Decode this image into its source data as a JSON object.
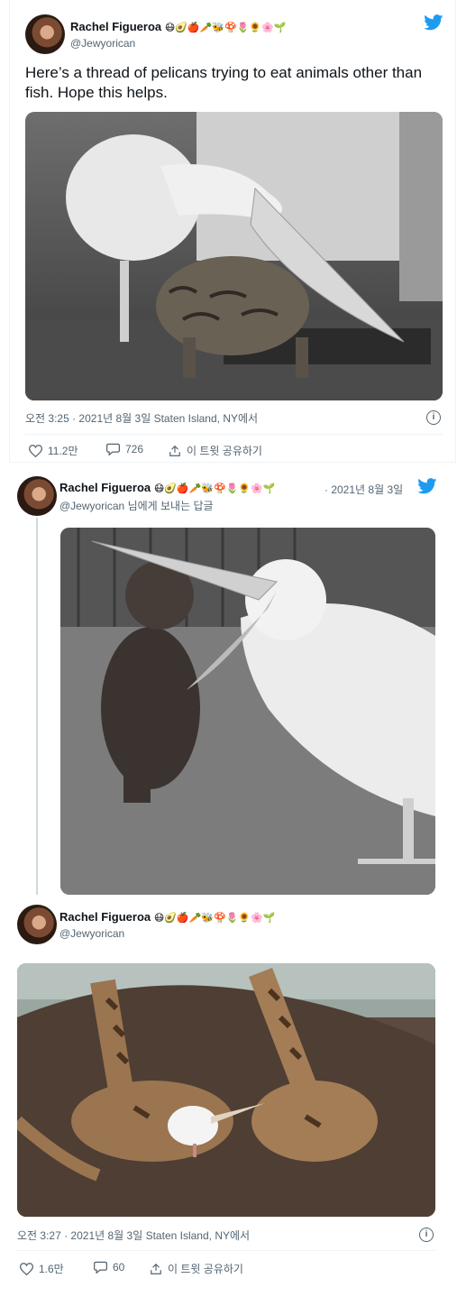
{
  "tweet1": {
    "author_name": "Rachel Figueroa",
    "emoji": "😷🥑🍎🥕🐝🍄🌷🌻🌸🌱",
    "handle": "@Jewyorican",
    "text": "Here’s a thread of pelicans trying to eat animals other than fish. Hope this helps.",
    "timestamp": "오전 3:25 · 2021년 8월 3일 Staten Island, NY에서",
    "likes": "11.2만",
    "replies": "726",
    "share_label": "이 트윗 공유하기"
  },
  "tweet2": {
    "author_name": "Rachel Figueroa",
    "emoji": "😷🥑🍎🥕🐝🍄🌷🌻🌸🌱",
    "date": "· 2021년 8월 3일",
    "handle": "@Jewyorican",
    "reply_to": "님에게 보내는 답글"
  },
  "tweet3": {
    "author_name": "Rachel Figueroa",
    "emoji": "😷🥑🍎🥕🐝🍄🌷🌻🌸🌱",
    "handle": "@Jewyorican",
    "timestamp": "오전 3:27 · 2021년 8월 3일 Staten Island, NY에서",
    "likes": "1.6만",
    "replies": "60",
    "share_label": "이 트윗 공유하기"
  },
  "colors": {
    "twitter_blue": "#1d9bf0",
    "secondary_text": "#536471"
  }
}
